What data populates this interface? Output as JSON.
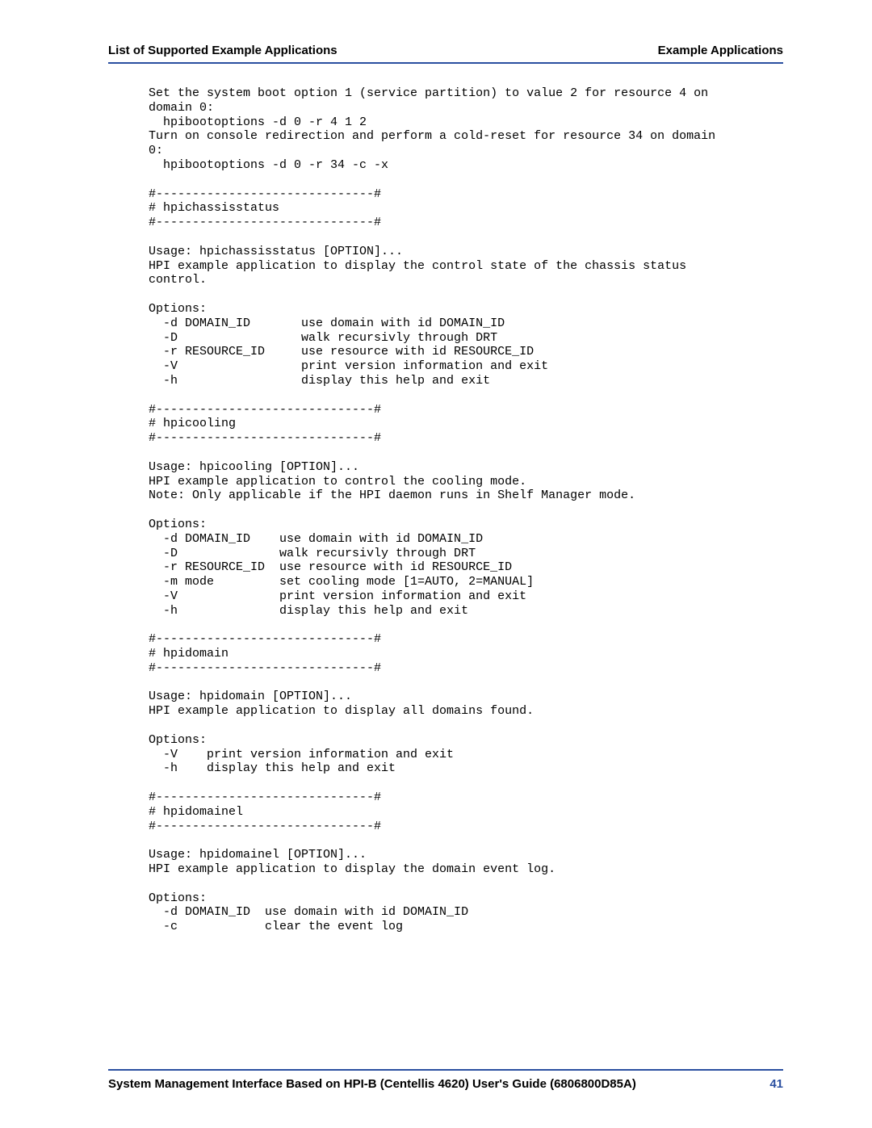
{
  "header": {
    "left": "List of Supported Example Applications",
    "right": "Example Applications"
  },
  "code": "Set the system boot option 1 (service partition) to value 2 for resource 4 on\ndomain 0:\n  hpibootoptions -d 0 -r 4 1 2\nTurn on console redirection and perform a cold-reset for resource 34 on domain\n0:\n  hpibootoptions -d 0 -r 34 -c -x\n\n#------------------------------#\n# hpichassisstatus\n#------------------------------#\n\nUsage: hpichassisstatus [OPTION]...\nHPI example application to display the control state of the chassis status\ncontrol.\n\nOptions:\n  -d DOMAIN_ID       use domain with id DOMAIN_ID\n  -D                 walk recursivly through DRT\n  -r RESOURCE_ID     use resource with id RESOURCE_ID\n  -V                 print version information and exit\n  -h                 display this help and exit\n\n#------------------------------#\n# hpicooling\n#------------------------------#\n\nUsage: hpicooling [OPTION]...\nHPI example application to control the cooling mode.\nNote: Only applicable if the HPI daemon runs in Shelf Manager mode.\n\nOptions:\n  -d DOMAIN_ID    use domain with id DOMAIN_ID\n  -D              walk recursivly through DRT\n  -r RESOURCE_ID  use resource with id RESOURCE_ID\n  -m mode         set cooling mode [1=AUTO, 2=MANUAL]\n  -V              print version information and exit\n  -h              display this help and exit\n\n#------------------------------#\n# hpidomain\n#------------------------------#\n\nUsage: hpidomain [OPTION]...\nHPI example application to display all domains found.\n\nOptions:\n  -V    print version information and exit\n  -h    display this help and exit\n\n#------------------------------#\n# hpidomainel\n#------------------------------#\n\nUsage: hpidomainel [OPTION]...\nHPI example application to display the domain event log.\n\nOptions:\n  -d DOMAIN_ID  use domain with id DOMAIN_ID\n  -c            clear the event log",
  "footer": {
    "text": "System Management Interface Based on HPI-B (Centellis 4620) User's Guide (6806800D85A)",
    "page": "41"
  }
}
